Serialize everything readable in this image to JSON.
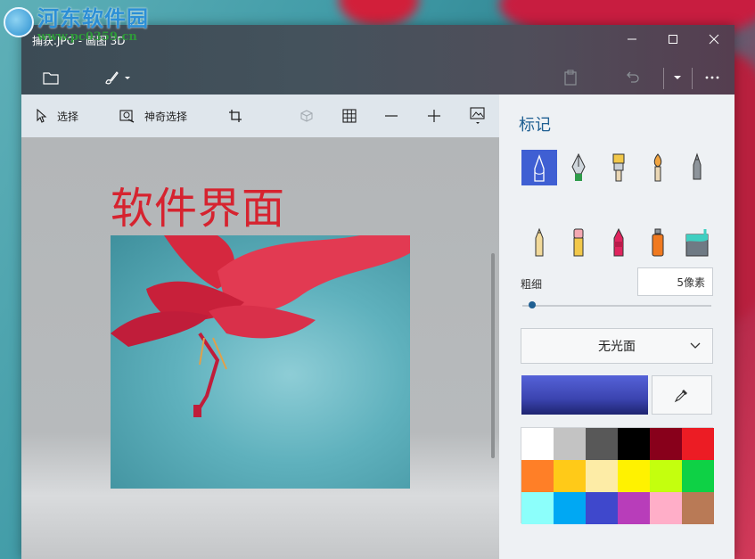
{
  "watermark": {
    "title": "河东软件园",
    "url": "www.pc0359.cn"
  },
  "window": {
    "title": "捕获.JPG - 画图 3D"
  },
  "toolbar": {
    "select_label": "选择",
    "magic_select_label": "神奇选择"
  },
  "canvas": {
    "title_text": "软件界面"
  },
  "sidebar": {
    "title": "标记",
    "thickness_label": "粗细",
    "thickness_value": "5像素",
    "thickness_level": 0.05,
    "finish_value": "无光面",
    "current_color": "#3b44b0",
    "brushes": [
      "marker-icon",
      "calligraphy-pen-icon",
      "oil-brush-icon",
      "watercolor-icon",
      "pixel-pen-icon",
      "pencil-icon",
      "eraser-icon",
      "crayon-icon",
      "spray-can-icon",
      "fill-bucket-icon"
    ],
    "palette": [
      "#ffffff",
      "#c3c3c3",
      "#585858",
      "#000000",
      "#88001b",
      "#ec1c24",
      "#ff7f27",
      "#ffca18",
      "#fdeca6",
      "#fff200",
      "#c4ff0e",
      "#0ed145",
      "#8cfffb",
      "#00a8f3",
      "#3f48cc",
      "#b83dba",
      "#ffaec8",
      "#b97a56"
    ]
  }
}
